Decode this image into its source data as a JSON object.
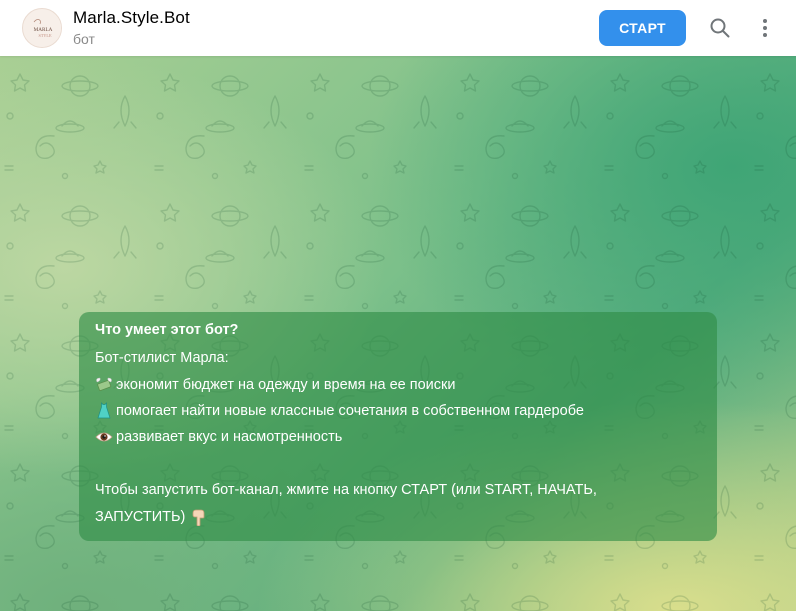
{
  "header": {
    "avatar_icon": "marla-style-logo",
    "avatar_text_1": "MARLA",
    "avatar_text_2": "STYLE",
    "title": "Marla.Style.Bot",
    "subtitle": "бот",
    "start_label": "СТАРТ",
    "search_icon": "search-icon",
    "more_icon": "more-vertical-icon"
  },
  "colors": {
    "accent": "#3390ec",
    "bubble": "#2f8d46",
    "title": "#000000",
    "subtitle": "#8a8a8a"
  },
  "bubble": {
    "heading": "Что умеет этот бот?",
    "intro": "Бот-стилист Марла:",
    "features": [
      {
        "icon": "money-with-wings-icon",
        "text": "экономит бюджет на одежду и время на ее поиски"
      },
      {
        "icon": "dress-icon",
        "text": "помогает найти новые классные сочетания в собственном гардеробе"
      },
      {
        "icon": "eye-icon",
        "text": "развивает вкус и насмотренность"
      }
    ],
    "cta_line1": "Чтобы запустить бот-канал, жмите на кнопку СТАРТ (или START, НАЧАТЬ,",
    "cta_line2": "ЗАПУСТИТЬ)",
    "cta_icon": "pointing-down-hand-icon"
  }
}
